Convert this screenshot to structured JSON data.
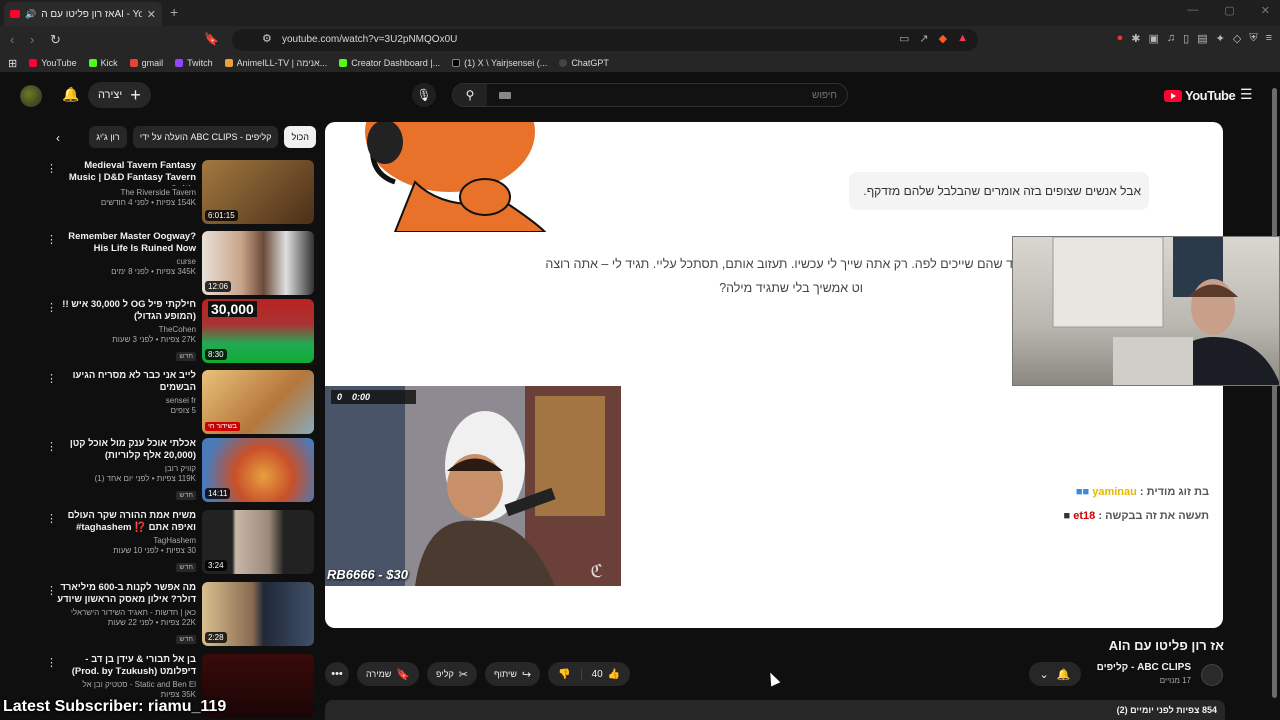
{
  "browser": {
    "tab_title": "אז רון פליטו עם הAI - YouTube",
    "url": "youtube.com/watch?v=3U2pNMQOx0U",
    "bookmarks": [
      {
        "label": "YouTube",
        "color": "#ff0033"
      },
      {
        "label": "Kick",
        "color": "#53fc18"
      },
      {
        "label": "gmail",
        "color": "#ea4335"
      },
      {
        "label": "Twitch",
        "color": "#9146ff"
      },
      {
        "label": "AnimeILL-TV | אנימה...",
        "color": "#e8a33a"
      },
      {
        "label": "Creator Dashboard |...",
        "color": "#53fc18"
      },
      {
        "label": "(1) X \\ Yairjsensei (...",
        "color": "#000000"
      },
      {
        "label": "ChatGPT",
        "color": "#444444"
      }
    ]
  },
  "header": {
    "create_label": "יצירה",
    "search_placeholder": "חיפוש",
    "logo_text": "YouTube"
  },
  "chips": [
    "הכול",
    "הועלה על ידי ABC CLIPS - קליפים",
    "רון ג'יג"
  ],
  "recommendations": [
    {
      "title": "Medieval Tavern Fantasy Music | D&D Fantasy Tavern Celtic ...",
      "channel": "The Riverside Tavern",
      "meta": "154K צפיות • לפני 4 חודשים",
      "duration": "6:01:15",
      "badge": "",
      "thumb_color": "#7a5a2e"
    },
    {
      "title": "Remember Master Oogway? His Life Is Ruined Now",
      "channel": "curse",
      "meta": "345K צפיות • לפני 8 ימים",
      "duration": "12:06",
      "badge": "",
      "thumb_color": "#5a5f6b"
    },
    {
      "title": "חילקתי פיל OG ל 30,000 איש !! (המופע הגדול)",
      "channel": "TheCohen",
      "meta": "27K צפיות • לפני 3 שעות",
      "duration": "8:30",
      "badge": "חדש",
      "thumb_color": "#1f5a2e",
      "overlay": "30,000"
    },
    {
      "title": "לייב אני כבר לא מסריח הגיעו הבשמים",
      "channel": "sensei fr",
      "meta": "5 צופים",
      "duration": "",
      "badge": "",
      "live": "בשידור חי",
      "thumb_color": "#d98a3a"
    },
    {
      "title": "אכלתי אוכל ענק מול אוכל קטן (20,000 אלף קלוריות)",
      "channel": "קוויק רובן",
      "meta": "119K צפיות • לפני יום אחד (1)",
      "duration": "14:11",
      "badge": "חדש",
      "thumb_color": "#c24a2a"
    },
    {
      "title": "משיח אמת ההורה שקר העולם ואיפה אתם ⁉️ taghashem#",
      "channel": "TagHashem",
      "meta": "30 צפיות • לפני 10 שעות",
      "duration": "3:24",
      "badge": "חדש",
      "thumb_color": "#8b8b8b"
    },
    {
      "title": "מה אפשר לקנות ב-600 מיליארד דולר? אילון מאסק הראשון שיודע",
      "channel": "כאן | חדשות - תאגיד השידור הישראלי",
      "meta": "22K צפיות • לפני 22 שעות",
      "duration": "2:28",
      "badge": "חדש",
      "thumb_color": "#3a4c6b"
    },
    {
      "title": "בן אל תבורי & עידן בן דב - דיפלומט (Prod. by Tzukush)",
      "channel": "Static and Ben El - סטטיק ובן אל",
      "meta": "35K צפיות",
      "duration": "",
      "badge": "",
      "thumb_color": "#3a1a1a"
    }
  ],
  "player": {
    "bubble_text": "אבל אנשים שצופים בזה אומרים שהבלבל שלהם מזדקף.",
    "paragraph_line1": "ד שהם שייכים לפה. רק אתה שייך לי עכשיו. תעזוב אותם, תסתכל עליי. תגיד לי – אתה רוצה",
    "paragraph_line2": "וט אמשיך בלי שתגיד מילה?",
    "hud_count": "0",
    "hud_time": "0:00",
    "donation": "RB6666 - $30",
    "chat": [
      {
        "user": "yaminau",
        "text": "בת זוג מודית :",
        "user_color": "#e6b800"
      },
      {
        "user": "et18",
        "text": "תעשה את זה בבקשה :",
        "user_color": "#cc0000"
      }
    ]
  },
  "video": {
    "title": "אז רון פליטו עם הAI",
    "channel": "ABC CLIPS - קליפים",
    "subscribers": "17 מנויים",
    "likes": "40",
    "share_label": "שיתוף",
    "clip_label": "קליפ",
    "save_label": "שמירה",
    "description_summary": "854 צפיות  לפני יומיים (2)"
  },
  "overlay": {
    "latest_subscriber": "Latest Subscriber: riamu_119"
  }
}
